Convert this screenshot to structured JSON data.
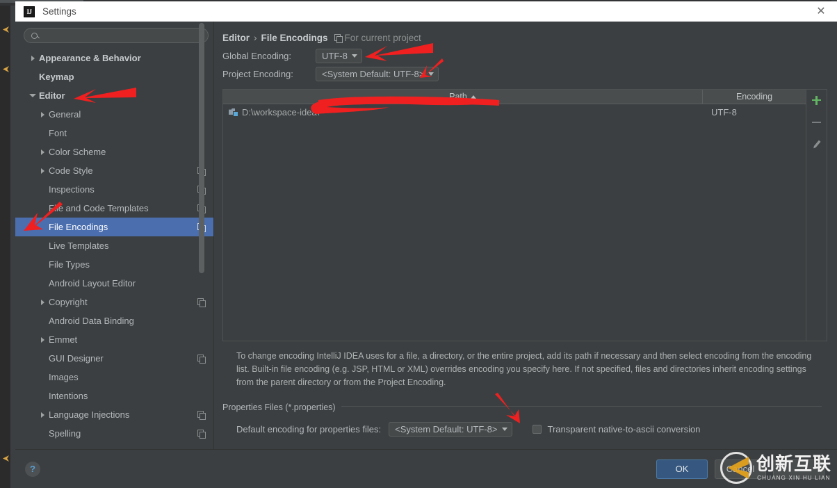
{
  "window": {
    "title": "Settings",
    "logo_text": "IJ",
    "close_icon": "close-icon"
  },
  "sidebar": {
    "search": {
      "value": "",
      "placeholder": ""
    },
    "items": [
      {
        "label": "Appearance & Behavior",
        "depth": 0,
        "twisty": "collapsed",
        "badge": false,
        "selected": false
      },
      {
        "label": "Keymap",
        "depth": 0,
        "twisty": "none",
        "badge": false,
        "selected": false
      },
      {
        "label": "Editor",
        "depth": 0,
        "twisty": "expanded",
        "badge": false,
        "selected": false
      },
      {
        "label": "General",
        "depth": 1,
        "twisty": "collapsed",
        "badge": false,
        "selected": false
      },
      {
        "label": "Font",
        "depth": 1,
        "twisty": "none",
        "badge": false,
        "selected": false
      },
      {
        "label": "Color Scheme",
        "depth": 1,
        "twisty": "collapsed",
        "badge": false,
        "selected": false
      },
      {
        "label": "Code Style",
        "depth": 1,
        "twisty": "collapsed",
        "badge": true,
        "selected": false
      },
      {
        "label": "Inspections",
        "depth": 1,
        "twisty": "none",
        "badge": true,
        "selected": false
      },
      {
        "label": "File and Code Templates",
        "depth": 1,
        "twisty": "none",
        "badge": true,
        "selected": false
      },
      {
        "label": "File Encodings",
        "depth": 1,
        "twisty": "none",
        "badge": true,
        "selected": true
      },
      {
        "label": "Live Templates",
        "depth": 1,
        "twisty": "none",
        "badge": false,
        "selected": false
      },
      {
        "label": "File Types",
        "depth": 1,
        "twisty": "none",
        "badge": false,
        "selected": false
      },
      {
        "label": "Android Layout Editor",
        "depth": 1,
        "twisty": "none",
        "badge": false,
        "selected": false
      },
      {
        "label": "Copyright",
        "depth": 1,
        "twisty": "collapsed",
        "badge": true,
        "selected": false
      },
      {
        "label": "Android Data Binding",
        "depth": 1,
        "twisty": "none",
        "badge": false,
        "selected": false
      },
      {
        "label": "Emmet",
        "depth": 1,
        "twisty": "collapsed",
        "badge": false,
        "selected": false
      },
      {
        "label": "GUI Designer",
        "depth": 1,
        "twisty": "none",
        "badge": true,
        "selected": false
      },
      {
        "label": "Images",
        "depth": 1,
        "twisty": "none",
        "badge": false,
        "selected": false
      },
      {
        "label": "Intentions",
        "depth": 1,
        "twisty": "none",
        "badge": false,
        "selected": false
      },
      {
        "label": "Language Injections",
        "depth": 1,
        "twisty": "collapsed",
        "badge": true,
        "selected": false
      },
      {
        "label": "Spelling",
        "depth": 1,
        "twisty": "none",
        "badge": true,
        "selected": false
      }
    ]
  },
  "main": {
    "breadcrumb": {
      "parent": "Editor",
      "separator": "›",
      "current": "File Encodings",
      "scope": "For current project"
    },
    "global_encoding": {
      "label": "Global Encoding:",
      "value": "UTF-8"
    },
    "project_encoding": {
      "label": "Project Encoding:",
      "value": "<System Default: UTF-8>"
    },
    "table": {
      "columns": [
        "Path",
        "Encoding"
      ],
      "sort_column": "Path",
      "sort_direction": "asc",
      "rows": [
        {
          "path": "D:\\workspace-idea\\",
          "encoding": "UTF-8"
        }
      ],
      "toolbar": [
        "add-icon",
        "remove-icon",
        "edit-icon"
      ]
    },
    "help_text": "To change encoding IntelliJ IDEA uses for a file, a directory, or the entire project, add its path if necessary and then select encoding from the encoding list. Built-in file encoding (e.g. JSP, HTML or XML) overrides encoding you specify here. If not specified, files and directories inherit encoding settings from the parent directory or from the Project Encoding.",
    "properties": {
      "legend": "Properties Files (*.properties)",
      "default_encoding_label": "Default encoding for properties files:",
      "default_encoding_value": "<System Default: UTF-8>",
      "transparent_label": "Transparent native-to-ascii conversion",
      "transparent_checked": false
    }
  },
  "footer": {
    "help_icon": "?",
    "buttons": [
      {
        "label": "OK",
        "style": "primary"
      },
      {
        "label": "Cancel",
        "style": "default"
      },
      {
        "label": "",
        "style": "default"
      }
    ]
  },
  "watermark": {
    "chinese": "创新互联",
    "pinyin": "CHUANG XIN HU LIAN"
  },
  "colors": {
    "selection": "#4b6eaf",
    "accent_primary": "#365880",
    "annotation_red": "#f02020",
    "add_green": "#62b562"
  }
}
